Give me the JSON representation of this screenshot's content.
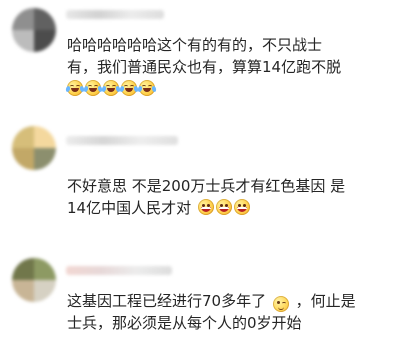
{
  "comments": [
    {
      "lines": [
        "哈哈哈哈哈哈这个有的有的，不只战士",
        "有，我们普通民众也有，算算14亿跑不脱"
      ],
      "emojis": [
        "laugh-cry-icon",
        "laugh-cry-icon",
        "laugh-cry-icon",
        "laugh-cry-icon",
        "laugh-cry-icon"
      ],
      "colors": {
        "avatar": [
          "#8f8f8f",
          "#616161",
          "#bcbcbc",
          "#4c4c4c"
        ]
      }
    },
    {
      "lines": [
        "不好意思 不是200万士兵才有红色基因 是",
        "14亿中国人民才对"
      ],
      "emojis": [
        "grin-icon",
        "grin-icon",
        "grin-icon"
      ],
      "colors": {
        "avatar": [
          "#d6be7a",
          "#f4d89e",
          "#c2a867",
          "#8c8f6e"
        ]
      }
    },
    {
      "lines": [
        "这基因工程已经进行70多年了",
        "，何止是",
        "士兵，那必须是从每个人的0岁开始"
      ],
      "emojis": [
        "wink-icon"
      ],
      "colors": {
        "avatar": [
          "#71774b",
          "#8d9a63",
          "#c8b596",
          "#d6d1c3"
        ]
      }
    }
  ]
}
